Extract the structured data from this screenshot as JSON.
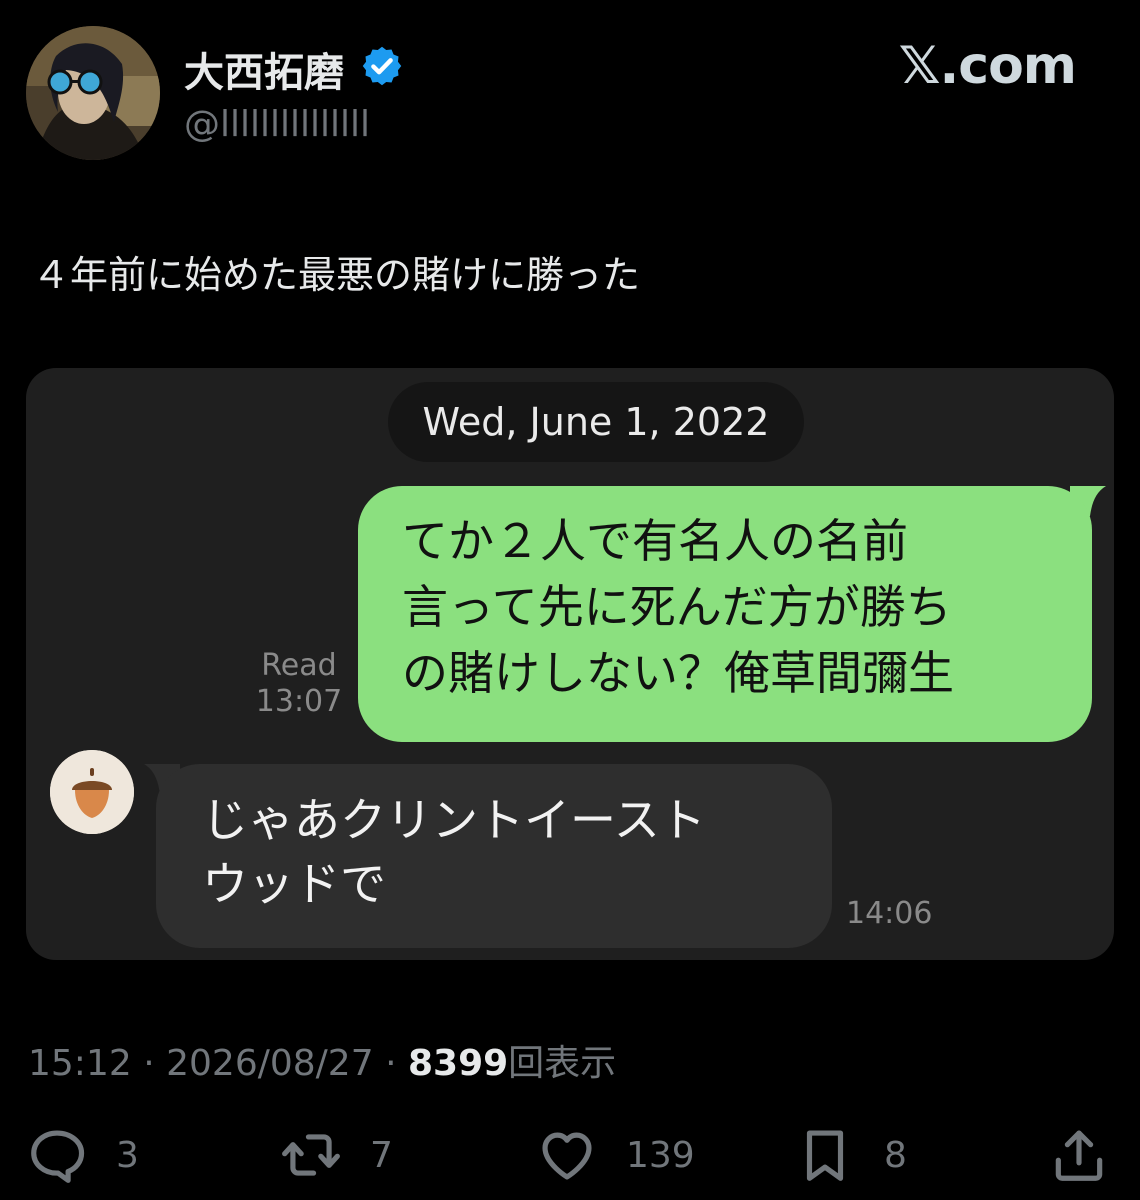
{
  "header": {
    "display_name": "大西拓磨",
    "handle": "@lllllllllllllll",
    "site": "𝕏.com"
  },
  "tweet": {
    "text": "４年前に始めた最悪の賭けに勝った"
  },
  "chat": {
    "date": "Wed, June 1, 2022",
    "outgoing": {
      "lines": [
        "てか２人で有名人の名前",
        "言って先に死んだ方が勝ち",
        "の賭けしない？俺草間彌生"
      ],
      "read_label": "Read",
      "time": "13:07"
    },
    "incoming": {
      "lines": [
        "じゃあクリントイースト",
        "ウッドで"
      ],
      "time": "14:06"
    }
  },
  "meta": {
    "time": "15:12",
    "date": "2026/08/27",
    "separator": "·",
    "views_count": "8399",
    "views_label": "回表示"
  },
  "actions": {
    "replies": "3",
    "reposts": "7",
    "likes": "139",
    "bookmarks": "8"
  },
  "colors": {
    "background": "#000000",
    "outgoing_bubble": "#8be07f",
    "incoming_bubble": "#2e2e2e",
    "verified_badge": "#1d9bf0",
    "muted_text": "#71767b"
  },
  "icons": [
    "verified-badge-icon",
    "reply-icon",
    "repost-icon",
    "like-icon",
    "bookmark-icon",
    "share-icon",
    "acorn-icon"
  ]
}
